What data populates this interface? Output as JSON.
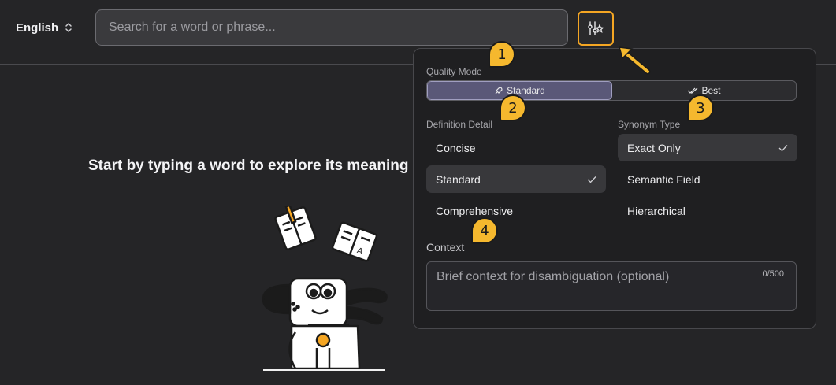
{
  "header": {
    "language": "English",
    "search_placeholder": "Search for a word or phrase..."
  },
  "empty_state": {
    "title": "Start by typing a word to explore its meaning"
  },
  "settings": {
    "quality_mode": {
      "label": "Quality Mode",
      "options": [
        "Standard",
        "Best"
      ],
      "selected": "Standard"
    },
    "definition_detail": {
      "label": "Definition Detail",
      "options": [
        "Concise",
        "Standard",
        "Comprehensive"
      ],
      "selected": "Standard"
    },
    "synonym_type": {
      "label": "Synonym Type",
      "options": [
        "Exact Only",
        "Semantic Field",
        "Hierarchical"
      ],
      "selected": "Exact Only"
    },
    "context": {
      "label": "Context",
      "placeholder": "Brief context for disambiguation (optional)",
      "counter": "0/500"
    }
  },
  "callouts": [
    "1",
    "2",
    "3",
    "4"
  ],
  "colors": {
    "accent": "#f5a623",
    "callout": "#f5b82e",
    "background": "#252527",
    "panel": "#1f1f21"
  }
}
